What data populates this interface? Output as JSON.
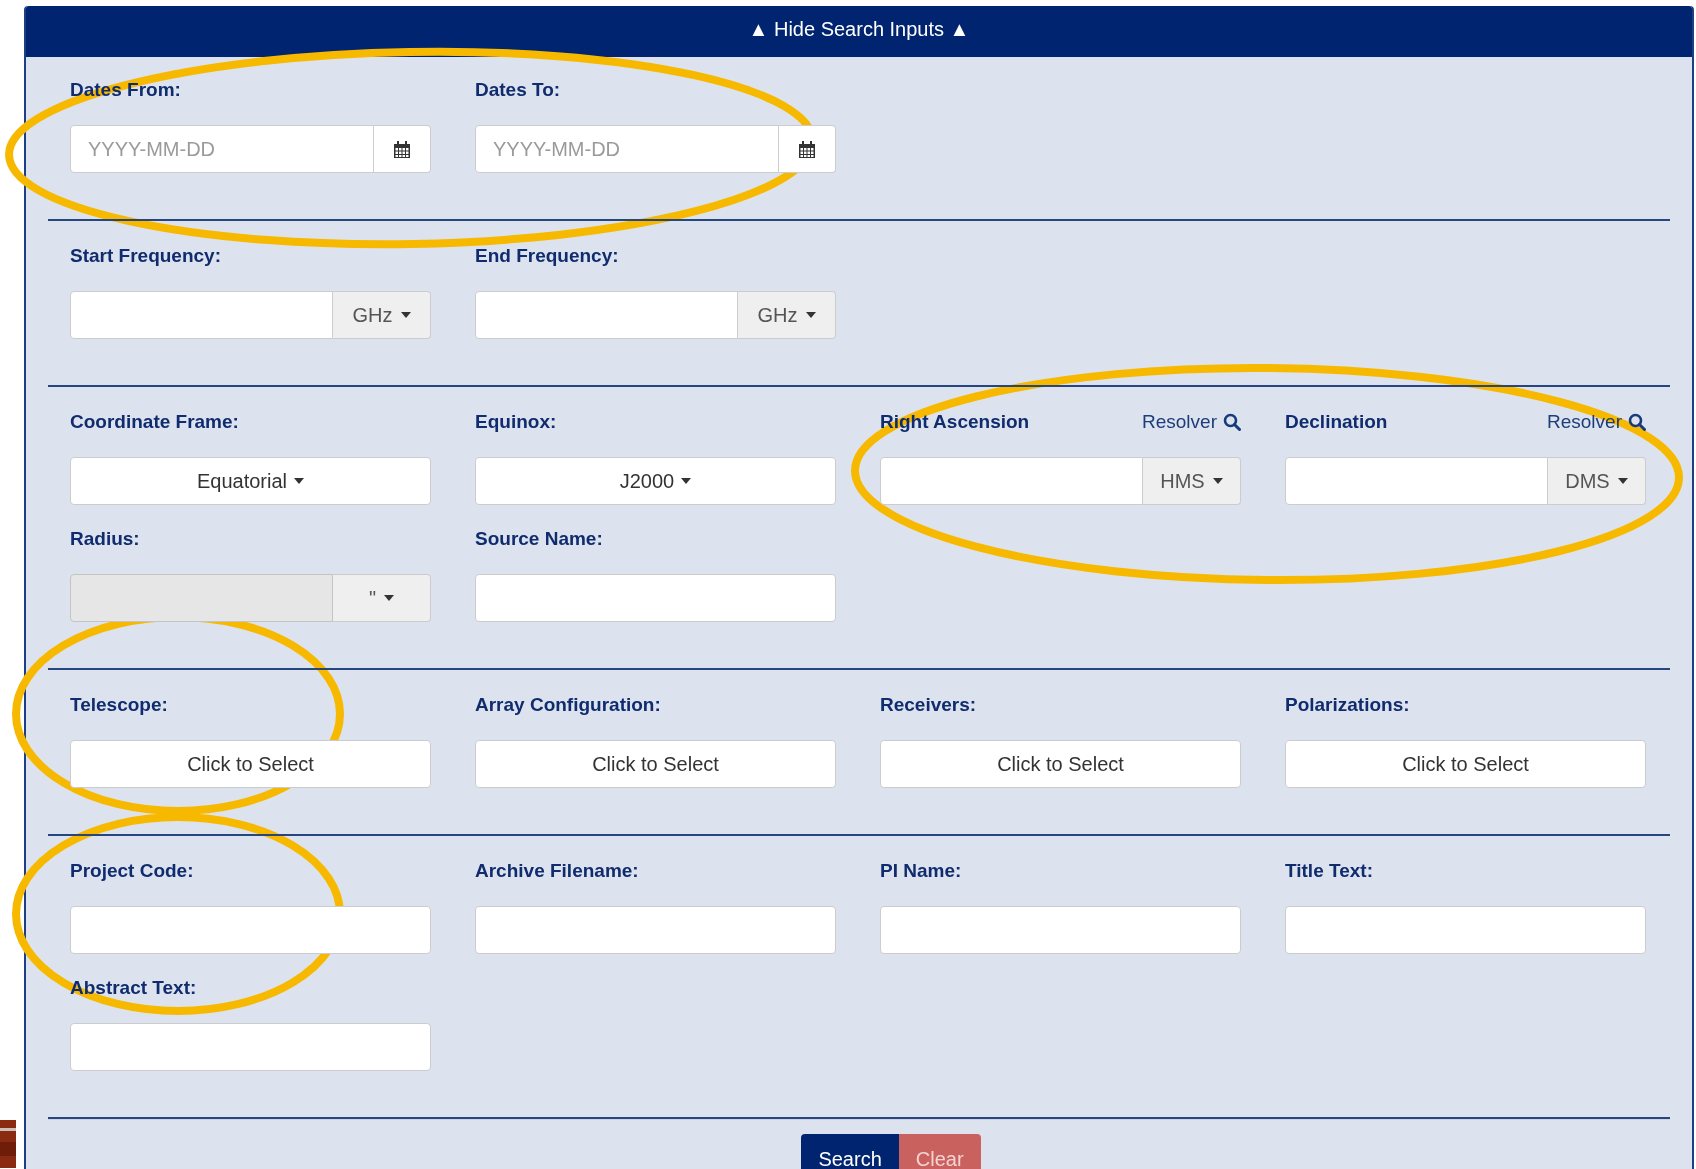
{
  "toggle": {
    "label": "▲ Hide Search Inputs ▲"
  },
  "sections": [
    {
      "fields": [
        {
          "label": "Dates From:",
          "kind": "date",
          "placeholder": "YYYY-MM-DD"
        },
        {
          "label": "Dates To:",
          "kind": "date",
          "placeholder": "YYYY-MM-DD"
        }
      ]
    },
    {
      "fields": [
        {
          "label": "Start Frequency:",
          "kind": "unit",
          "unit": "GHz",
          "disabled": false
        },
        {
          "label": "End Frequency:",
          "kind": "unit",
          "unit": "GHz",
          "disabled": false
        }
      ]
    },
    {
      "fields": [
        {
          "label": "Coordinate Frame:",
          "kind": "select",
          "value": "Equatorial"
        },
        {
          "label": "Equinox:",
          "kind": "select",
          "value": "J2000"
        },
        {
          "label": "Right Ascension",
          "link": "Resolver",
          "kind": "unit",
          "unit": "HMS",
          "disabled": false
        },
        {
          "label": "Declination",
          "link": "Resolver",
          "kind": "unit",
          "unit": "DMS",
          "disabled": false
        },
        {
          "label": "Radius:",
          "kind": "unit",
          "unit": "\"",
          "disabled": true
        },
        {
          "label": "Source Name:",
          "kind": "text"
        }
      ]
    },
    {
      "fields": [
        {
          "label": "Telescope:",
          "kind": "picker",
          "value": "Click to Select"
        },
        {
          "label": "Array Configuration:",
          "kind": "picker",
          "value": "Click to Select"
        },
        {
          "label": "Receivers:",
          "kind": "picker",
          "value": "Click to Select"
        },
        {
          "label": "Polarizations:",
          "kind": "picker",
          "value": "Click to Select"
        }
      ]
    },
    {
      "fields": [
        {
          "label": "Project Code:",
          "kind": "text"
        },
        {
          "label": "Archive Filename:",
          "kind": "text"
        },
        {
          "label": "PI Name:",
          "kind": "text"
        },
        {
          "label": "Title Text:",
          "kind": "text"
        },
        {
          "label": "Abstract Text:",
          "kind": "text"
        }
      ]
    }
  ],
  "buttons": [
    {
      "label": "Search",
      "kind": "primary"
    },
    {
      "label": "Clear",
      "kind": "danger"
    }
  ],
  "annotations": [
    {
      "kind": "ellipse"
    },
    {
      "kind": "ellipse"
    },
    {
      "kind": "ellipse"
    },
    {
      "kind": "ellipse"
    }
  ]
}
